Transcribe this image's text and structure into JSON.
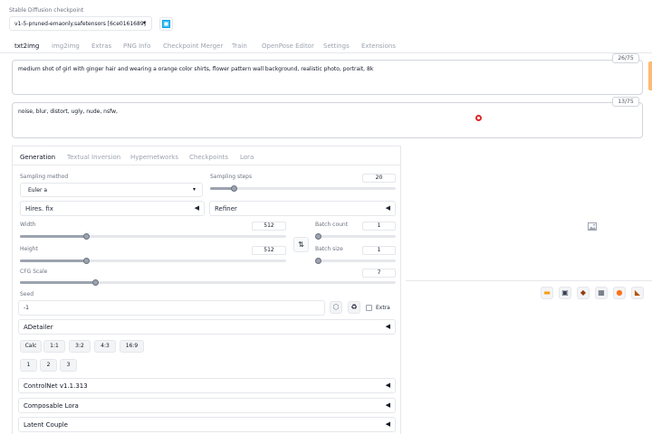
{
  "checkpoint": {
    "label": "Stable Diffusion checkpoint",
    "value": "v1-5-pruned-emaonly.safetensors [6ce0161689]"
  },
  "main_tabs": [
    "txt2img",
    "img2img",
    "Extras",
    "PNG Info",
    "Checkpoint Merger",
    "Train",
    "OpenPose Editor",
    "Settings",
    "Extensions"
  ],
  "prompt": {
    "text": "medium shot of girl with ginger hair and wearing a orange color shirts, flower pattern wall background, realistic photo, portrait, 8k",
    "counter": "26/75"
  },
  "negative_prompt": {
    "text": "noise, blur, distort, ugly, nude, nsfw,",
    "counter": "13/75"
  },
  "sub_tabs": [
    "Generation",
    "Textual Inversion",
    "Hypernetworks",
    "Checkpoints",
    "Lora"
  ],
  "sampling": {
    "method_label": "Sampling method",
    "method_value": "Euler a",
    "steps_label": "Sampling steps",
    "steps_value": "20",
    "steps_fraction": 0.13
  },
  "hires_fix": "Hires. fix",
  "refiner": "Refiner",
  "width": {
    "label": "Width",
    "value": "512",
    "fraction": 0.25
  },
  "height": {
    "label": "Height",
    "value": "512",
    "fraction": 0.25
  },
  "batch_count": {
    "label": "Batch count",
    "value": "1",
    "fraction": 0.0
  },
  "batch_size": {
    "label": "Batch size",
    "value": "1",
    "fraction": 0.0
  },
  "cfg": {
    "label": "CFG Scale",
    "value": "7",
    "fraction": 0.2
  },
  "seed": {
    "label": "Seed",
    "value": "-1",
    "extra_label": "Extra"
  },
  "adetailer": "ADetailer",
  "ratio_buttons": [
    "Calc",
    "1:1",
    "3:2",
    "4:3",
    "16:9"
  ],
  "number_buttons": [
    "1",
    "2",
    "3"
  ],
  "accordions": [
    "ControlNet v1.1.313",
    "Composable Lora",
    "Latent Couple"
  ],
  "colors": {
    "accent": "#f97316",
    "border": "#e5e7eb"
  }
}
